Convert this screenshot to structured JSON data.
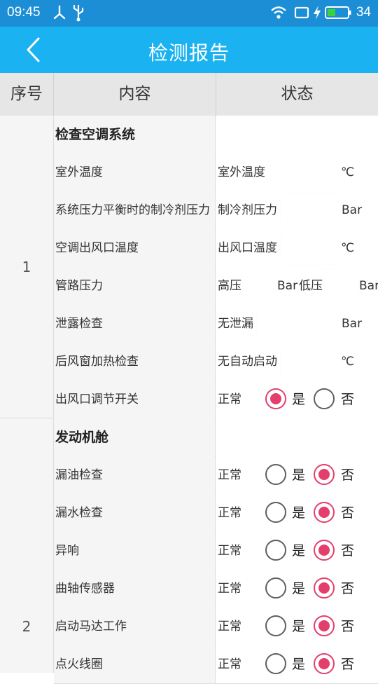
{
  "status_bar": {
    "time": "09:45",
    "battery": "34"
  },
  "app_bar": {
    "title": "检测报告",
    "back_icon": "back-chevron-icon"
  },
  "table": {
    "headers": [
      "序号",
      "内容",
      "状态"
    ]
  },
  "groups": [
    {
      "seq": "1",
      "section": "检查空调系统",
      "rows": [
        {
          "content": "室外温度",
          "label": "室外温度",
          "unit": "℃"
        },
        {
          "content": "系统压力平衡时的制冷剂压力",
          "label": "制冷剂压力",
          "unit": "Bar"
        },
        {
          "content": "空调出风口温度",
          "label": "出风口温度",
          "unit": "℃"
        },
        {
          "content": "管路压力",
          "label": "高压",
          "unit": "Bar",
          "label2": "低压",
          "unit2": "Bar"
        },
        {
          "content": "泄露检查",
          "label": "无泄漏",
          "unit": "Bar"
        },
        {
          "content": "后风窗加热检查",
          "label": "无自动启动",
          "unit": "℃"
        },
        {
          "content": "出风口调节开关",
          "label": "正常",
          "yes": "是",
          "no": "否",
          "selected": "yes"
        }
      ]
    },
    {
      "seq": "2",
      "section": "发动机舱",
      "rows": [
        {
          "content": "漏油检查",
          "label": "正常",
          "yes": "是",
          "no": "否",
          "selected": "no"
        },
        {
          "content": "漏水检查",
          "label": "正常",
          "yes": "是",
          "no": "否",
          "selected": "no"
        },
        {
          "content": "异响",
          "label": "正常",
          "yes": "是",
          "no": "否",
          "selected": "no"
        },
        {
          "content": "曲轴传感器",
          "label": "正常",
          "yes": "是",
          "no": "否",
          "selected": "no"
        },
        {
          "content": "启动马达工作",
          "label": "正常",
          "yes": "是",
          "no": "否",
          "selected": "no"
        },
        {
          "content": "点火线圈",
          "label": "正常",
          "yes": "是",
          "no": "否",
          "selected": "no"
        }
      ]
    }
  ],
  "colors": {
    "status_bar": "#1c8ed6",
    "app_bar": "#1ab2f0",
    "radio_selected": "#e33f6d",
    "cell_bg": "#f5f5f5"
  }
}
